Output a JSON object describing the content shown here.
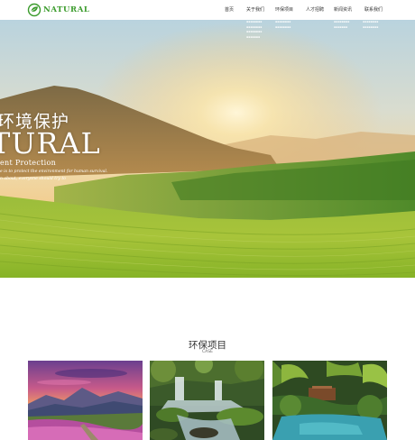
{
  "header": {
    "logo_text": "NATURAL",
    "brand_color": "#3a9b2b",
    "nav": [
      {
        "label": "首页"
      },
      {
        "label": "关于我们"
      },
      {
        "label": "环保项目"
      },
      {
        "label": "人才招聘"
      },
      {
        "label": "新闻资讯"
      },
      {
        "label": "联系我们"
      }
    ]
  },
  "hero": {
    "title_cn": "环境保护",
    "title_en": "TURAL",
    "subtitle": "ent Protection",
    "desc_line1": "e is to protect the environment for human survival.",
    "desc_line2": "n about, everyone should try to"
  },
  "projects": {
    "title": "环保项目",
    "subtitle": "CASE",
    "items": [
      {
        "image": "mountain-flower-field"
      },
      {
        "image": "forest-waterfall"
      },
      {
        "image": "tropical-pond"
      }
    ]
  }
}
